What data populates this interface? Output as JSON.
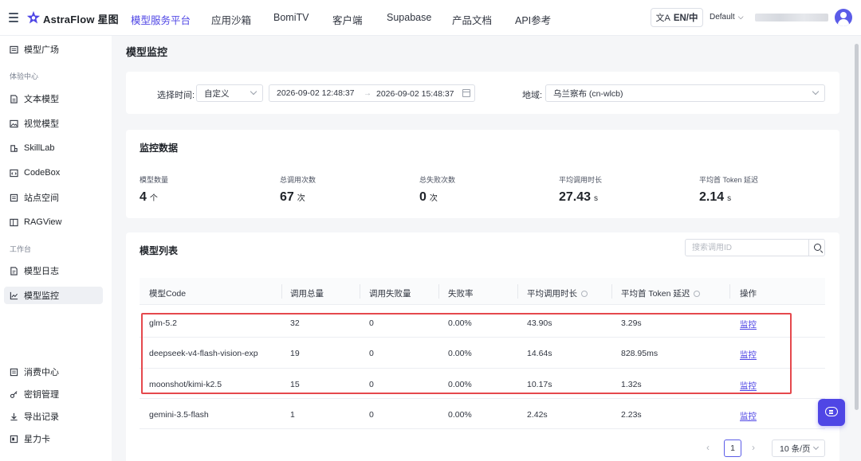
{
  "header": {
    "brand": "AstraFlow 星图",
    "nav": [
      "模型服务平台",
      "应用沙箱",
      "BomiTV",
      "客户端",
      "Supabase",
      "产品文档",
      "API参考"
    ],
    "active_nav": "模型服务平台",
    "lang": "EN/中",
    "workspace": "Default",
    "icons": [
      "menu-icon",
      "translate-icon",
      "chevron-down-icon",
      "avatar-icon"
    ],
    "accent_color": "#4f46e5"
  },
  "sidebar": {
    "top_item": "模型广场",
    "group_experience": "体验中心",
    "experience_items": [
      "文本模型",
      "视觉模型",
      "SkillLab",
      "CodeBox",
      "站点空间",
      "RAGView"
    ],
    "group_workspace": "工作台",
    "workspace_items": [
      "模型日志",
      "模型监控"
    ],
    "active_item": "模型监控",
    "bottom_items": [
      "消费中心",
      "密钥管理",
      "导出记录",
      "星力卡"
    ]
  },
  "page": {
    "title": "模型监控"
  },
  "filters": {
    "time_label": "选择时间:",
    "time_mode": "自定义",
    "start": "2026-09-02 12:48:37",
    "end": "2026-09-02 15:48:37",
    "range_arrow": "→",
    "region_label": "地域:",
    "region": "乌兰察布 (cn-wlcb)"
  },
  "stats": {
    "title": "监控数据",
    "items": [
      {
        "label": "模型数量",
        "value": "4",
        "unit": "个"
      },
      {
        "label": "总调用次数",
        "value": "67",
        "unit": "次"
      },
      {
        "label": "总失败次数",
        "value": "0",
        "unit": "次"
      },
      {
        "label": "平均调用时长",
        "value": "27.43",
        "unit": "s"
      },
      {
        "label": "平均首 Token 延迟",
        "value": "2.14",
        "unit": "s"
      }
    ]
  },
  "table": {
    "title": "模型列表",
    "search_placeholder": "搜索调用ID",
    "columns": [
      "模型Code",
      "调用总量",
      "调用失败量",
      "失败率",
      "平均调用时长",
      "平均首 Token 延迟",
      "操作"
    ],
    "rows": [
      {
        "code": "glm-5.2",
        "total": "32",
        "failed": "0",
        "rate": "0.00%",
        "avg": "43.90s",
        "ttft": "3.29s",
        "action": "监控"
      },
      {
        "code": "deepseek-v4-flash-vision-exp",
        "total": "19",
        "failed": "0",
        "rate": "0.00%",
        "avg": "14.64s",
        "ttft": "828.95ms",
        "action": "监控"
      },
      {
        "code": "moonshot/kimi-k2.5",
        "total": "15",
        "failed": "0",
        "rate": "0.00%",
        "avg": "10.17s",
        "ttft": "1.32s",
        "action": "监控"
      },
      {
        "code": "gemini-3.5-flash",
        "total": "1",
        "failed": "0",
        "rate": "0.00%",
        "avg": "2.42s",
        "ttft": "2.23s",
        "action": "监控"
      }
    ],
    "highlight_color": "#e5484d"
  },
  "pagination": {
    "prev": "‹",
    "current": "1",
    "next": "›",
    "page_size": "10 条/页"
  }
}
